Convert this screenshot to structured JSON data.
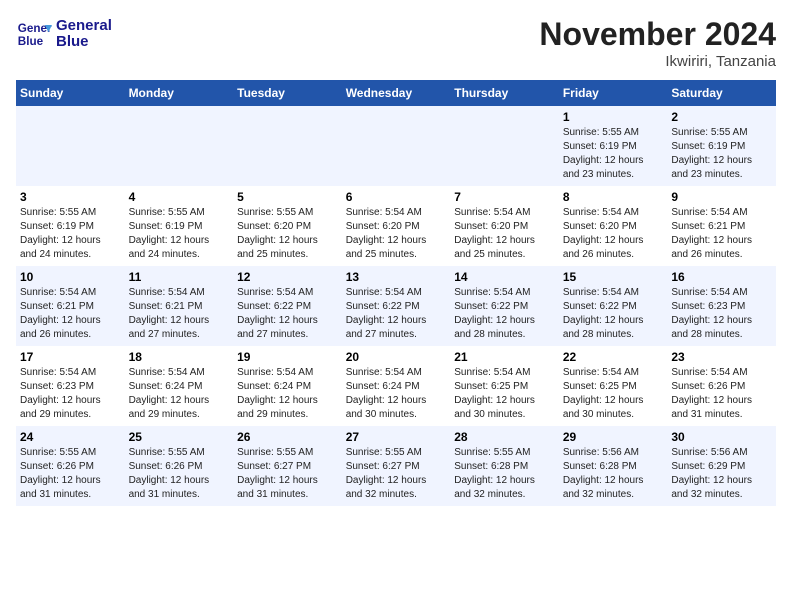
{
  "header": {
    "logo_line1": "General",
    "logo_line2": "Blue",
    "title": "November 2024",
    "subtitle": "Ikwiriri, Tanzania"
  },
  "weekdays": [
    "Sunday",
    "Monday",
    "Tuesday",
    "Wednesday",
    "Thursday",
    "Friday",
    "Saturday"
  ],
  "weeks": [
    [
      {
        "day": "",
        "info": ""
      },
      {
        "day": "",
        "info": ""
      },
      {
        "day": "",
        "info": ""
      },
      {
        "day": "",
        "info": ""
      },
      {
        "day": "",
        "info": ""
      },
      {
        "day": "1",
        "info": "Sunrise: 5:55 AM\nSunset: 6:19 PM\nDaylight: 12 hours\nand 23 minutes."
      },
      {
        "day": "2",
        "info": "Sunrise: 5:55 AM\nSunset: 6:19 PM\nDaylight: 12 hours\nand 23 minutes."
      }
    ],
    [
      {
        "day": "3",
        "info": "Sunrise: 5:55 AM\nSunset: 6:19 PM\nDaylight: 12 hours\nand 24 minutes."
      },
      {
        "day": "4",
        "info": "Sunrise: 5:55 AM\nSunset: 6:19 PM\nDaylight: 12 hours\nand 24 minutes."
      },
      {
        "day": "5",
        "info": "Sunrise: 5:55 AM\nSunset: 6:20 PM\nDaylight: 12 hours\nand 25 minutes."
      },
      {
        "day": "6",
        "info": "Sunrise: 5:54 AM\nSunset: 6:20 PM\nDaylight: 12 hours\nand 25 minutes."
      },
      {
        "day": "7",
        "info": "Sunrise: 5:54 AM\nSunset: 6:20 PM\nDaylight: 12 hours\nand 25 minutes."
      },
      {
        "day": "8",
        "info": "Sunrise: 5:54 AM\nSunset: 6:20 PM\nDaylight: 12 hours\nand 26 minutes."
      },
      {
        "day": "9",
        "info": "Sunrise: 5:54 AM\nSunset: 6:21 PM\nDaylight: 12 hours\nand 26 minutes."
      }
    ],
    [
      {
        "day": "10",
        "info": "Sunrise: 5:54 AM\nSunset: 6:21 PM\nDaylight: 12 hours\nand 26 minutes."
      },
      {
        "day": "11",
        "info": "Sunrise: 5:54 AM\nSunset: 6:21 PM\nDaylight: 12 hours\nand 27 minutes."
      },
      {
        "day": "12",
        "info": "Sunrise: 5:54 AM\nSunset: 6:22 PM\nDaylight: 12 hours\nand 27 minutes."
      },
      {
        "day": "13",
        "info": "Sunrise: 5:54 AM\nSunset: 6:22 PM\nDaylight: 12 hours\nand 27 minutes."
      },
      {
        "day": "14",
        "info": "Sunrise: 5:54 AM\nSunset: 6:22 PM\nDaylight: 12 hours\nand 28 minutes."
      },
      {
        "day": "15",
        "info": "Sunrise: 5:54 AM\nSunset: 6:22 PM\nDaylight: 12 hours\nand 28 minutes."
      },
      {
        "day": "16",
        "info": "Sunrise: 5:54 AM\nSunset: 6:23 PM\nDaylight: 12 hours\nand 28 minutes."
      }
    ],
    [
      {
        "day": "17",
        "info": "Sunrise: 5:54 AM\nSunset: 6:23 PM\nDaylight: 12 hours\nand 29 minutes."
      },
      {
        "day": "18",
        "info": "Sunrise: 5:54 AM\nSunset: 6:24 PM\nDaylight: 12 hours\nand 29 minutes."
      },
      {
        "day": "19",
        "info": "Sunrise: 5:54 AM\nSunset: 6:24 PM\nDaylight: 12 hours\nand 29 minutes."
      },
      {
        "day": "20",
        "info": "Sunrise: 5:54 AM\nSunset: 6:24 PM\nDaylight: 12 hours\nand 30 minutes."
      },
      {
        "day": "21",
        "info": "Sunrise: 5:54 AM\nSunset: 6:25 PM\nDaylight: 12 hours\nand 30 minutes."
      },
      {
        "day": "22",
        "info": "Sunrise: 5:54 AM\nSunset: 6:25 PM\nDaylight: 12 hours\nand 30 minutes."
      },
      {
        "day": "23",
        "info": "Sunrise: 5:54 AM\nSunset: 6:26 PM\nDaylight: 12 hours\nand 31 minutes."
      }
    ],
    [
      {
        "day": "24",
        "info": "Sunrise: 5:55 AM\nSunset: 6:26 PM\nDaylight: 12 hours\nand 31 minutes."
      },
      {
        "day": "25",
        "info": "Sunrise: 5:55 AM\nSunset: 6:26 PM\nDaylight: 12 hours\nand 31 minutes."
      },
      {
        "day": "26",
        "info": "Sunrise: 5:55 AM\nSunset: 6:27 PM\nDaylight: 12 hours\nand 31 minutes."
      },
      {
        "day": "27",
        "info": "Sunrise: 5:55 AM\nSunset: 6:27 PM\nDaylight: 12 hours\nand 32 minutes."
      },
      {
        "day": "28",
        "info": "Sunrise: 5:55 AM\nSunset: 6:28 PM\nDaylight: 12 hours\nand 32 minutes."
      },
      {
        "day": "29",
        "info": "Sunrise: 5:56 AM\nSunset: 6:28 PM\nDaylight: 12 hours\nand 32 minutes."
      },
      {
        "day": "30",
        "info": "Sunrise: 5:56 AM\nSunset: 6:29 PM\nDaylight: 12 hours\nand 32 minutes."
      }
    ]
  ]
}
